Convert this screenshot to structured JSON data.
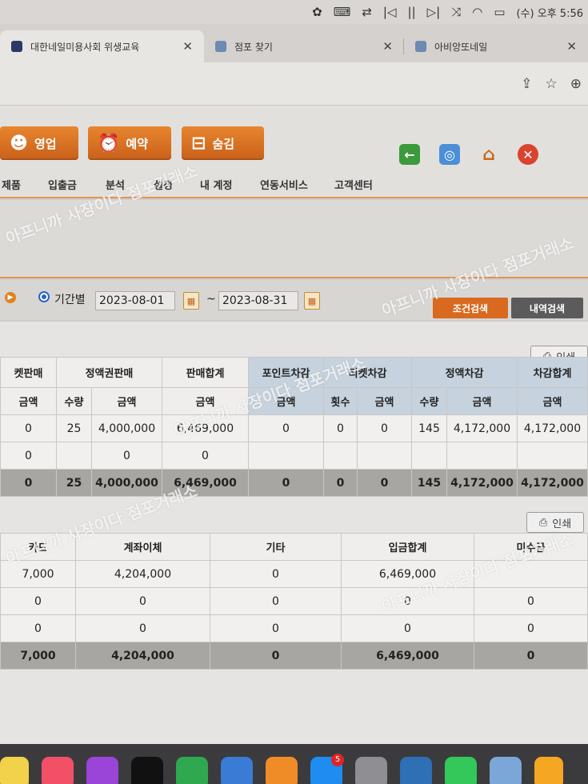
{
  "menubar": {
    "clock": "(수) 오후 5:56"
  },
  "tabs": [
    {
      "label": "대한네일미용사회 위생교육"
    },
    {
      "label": "점포 찾기"
    },
    {
      "label": "아비앙또네일"
    }
  ],
  "header_buttons": [
    {
      "label": "영업"
    },
    {
      "label": "예약"
    },
    {
      "label": "숨김"
    }
  ],
  "menu": [
    "제품",
    "입출금",
    "분석",
    "설정",
    "내 계정",
    "연동서비스",
    "고객센터"
  ],
  "search": {
    "period_label": "기간별",
    "start_date": "2023-08-01",
    "tilde": "~",
    "end_date": "2023-08-31",
    "search_button": "조건검색",
    "history_button": "내역검색"
  },
  "print_label": "인쇄",
  "sales_table": {
    "group_headers": [
      "켓판매",
      "정액권판매",
      "판매합계",
      "포인트차감",
      "티켓차감",
      "정액차감",
      "차감합계"
    ],
    "sub_headers": [
      "금액",
      "수량",
      "금액",
      "금액",
      "금액",
      "횟수",
      "금액",
      "수량",
      "금액",
      "금액"
    ],
    "rows": [
      [
        "0",
        "25",
        "4,000,000",
        "6,469,000",
        "0",
        "0",
        "0",
        "145",
        "4,172,000",
        "4,172,000"
      ],
      [
        "0",
        "",
        "0",
        "0",
        "",
        "",
        "",
        "",
        "",
        ""
      ]
    ],
    "total": [
      "0",
      "25",
      "4,000,000",
      "6,469,000",
      "0",
      "0",
      "0",
      "145",
      "4,172,000",
      "4,172,000"
    ]
  },
  "payment_table": {
    "headers": [
      "카드",
      "계좌이체",
      "기타",
      "입금합계",
      "미수금"
    ],
    "rows": [
      [
        "7,000",
        "4,204,000",
        "0",
        "6,469,000",
        ""
      ],
      [
        "0",
        "0",
        "0",
        "0",
        "0"
      ],
      [
        "0",
        "0",
        "0",
        "0",
        "0"
      ]
    ],
    "total": [
      "7,000",
      "4,204,000",
      "0",
      "6,469,000",
      "0"
    ]
  },
  "watermark": "아프니까 사장이다 점포거래소",
  "colors": {
    "accent_orange": "#d9691f",
    "dark_button": "#5b5b5b",
    "header_blue": "#c6d2de"
  }
}
